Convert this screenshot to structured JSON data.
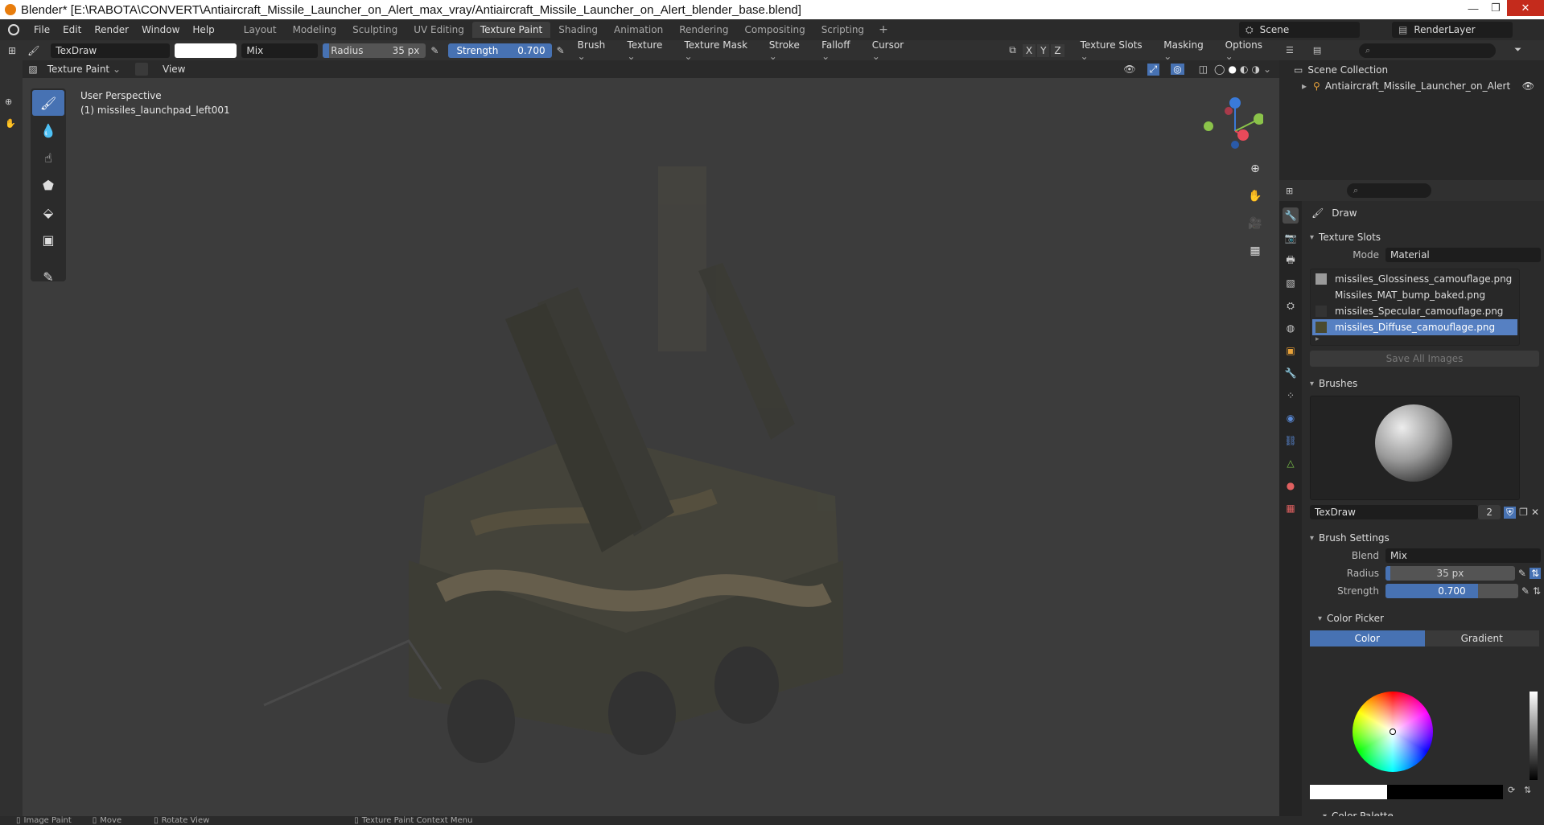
{
  "window": {
    "title": "Blender* [E:\\RABOTA\\CONVERT\\Antiaircraft_Missile_Launcher_on_Alert_max_vray/Antiaircraft_Missile_Launcher_on_Alert_blender_base.blend]"
  },
  "menu": [
    "File",
    "Edit",
    "Render",
    "Window",
    "Help"
  ],
  "workspaces": [
    "Layout",
    "Modeling",
    "Sculpting",
    "UV Editing",
    "Texture Paint",
    "Shading",
    "Animation",
    "Rendering",
    "Compositing",
    "Scripting"
  ],
  "active_workspace": "Texture Paint",
  "scene": {
    "scene_name": "Scene",
    "view_layer": "RenderLayer"
  },
  "tool_header": {
    "brush_name": "TexDraw",
    "blend": "Mix",
    "radius_label": "Radius",
    "radius_value": "35 px",
    "strength_label": "Strength",
    "strength_value": "0.700",
    "menus": [
      "Brush",
      "Texture",
      "Texture Mask",
      "Stroke",
      "Falloff",
      "Cursor"
    ],
    "axes": [
      "X",
      "Y",
      "Z"
    ],
    "right_menus": [
      "Texture Slots",
      "Masking",
      "Options"
    ]
  },
  "header2": {
    "mode": "Texture Paint",
    "view": "View"
  },
  "viewport": {
    "perspective": "User Perspective",
    "object": "(1) missiles_launchpad_left001"
  },
  "outliner": {
    "collection": "Scene Collection",
    "object": "Antiaircraft_Missile_Launcher_on_Alert"
  },
  "properties": {
    "tool_name": "Draw",
    "texture_slots": {
      "title": "Texture Slots",
      "mode_label": "Mode",
      "mode_value": "Material",
      "slots": [
        "missiles_Glossiness_camouflage.png",
        "Missiles_MAT_bump_baked.png",
        "missiles_Specular_camouflage.png",
        "missiles_Diffuse_camouflage.png"
      ],
      "active_slot": 3,
      "save_label": "Save All Images"
    },
    "brushes": {
      "title": "Brushes",
      "brush_name": "TexDraw",
      "users": "2"
    },
    "brush_settings": {
      "title": "Brush Settings",
      "blend_label": "Blend",
      "blend_value": "Mix",
      "radius_label": "Radius",
      "radius_value": "35 px",
      "strength_label": "Strength",
      "strength_value": "0.700",
      "strength_fraction": 0.7
    },
    "color_picker": {
      "title": "Color Picker",
      "color_tab": "Color",
      "gradient_tab": "Gradient"
    },
    "color_palette": "Color Palette"
  },
  "status_bar": [
    "Image Paint",
    "Move",
    "Rotate View",
    "Texture Paint Context Menu"
  ],
  "colors": {
    "accent": "#4772b3",
    "active_slot": "#5680c2",
    "blender_orange": "#e87d0d"
  }
}
